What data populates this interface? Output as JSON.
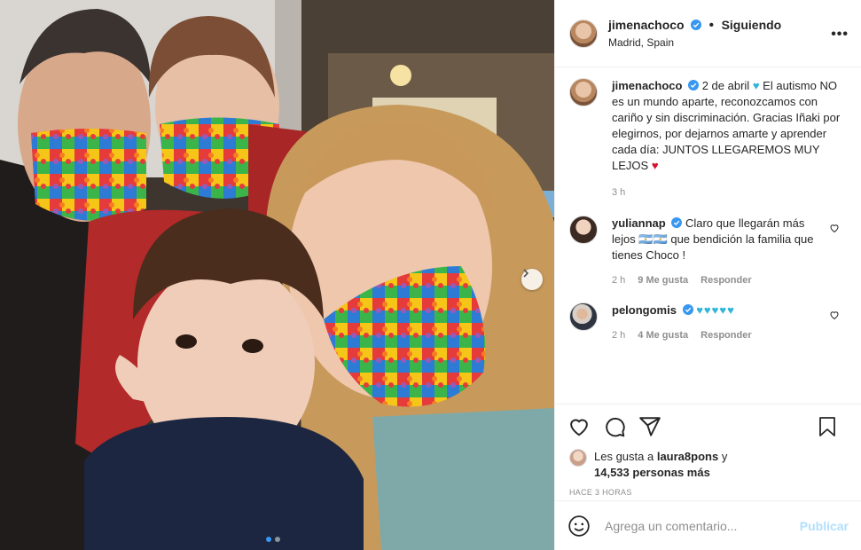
{
  "post": {
    "author": "jimenachoco",
    "follow_status": "Siguiendo",
    "separator": "•",
    "location": "Madrid, Spain",
    "more_icon": "more-horizontal-icon"
  },
  "caption": {
    "username": "jimenachoco",
    "date": "2 de abril",
    "text": "El autismo NO es un mundo aparte, reconozcamos con cariño y sin discriminación. Gracias Iñaki por elegirnos, por dejarnos amarte y aprender cada día: JUNTOS LLEGAREMOS MUY LEJOS",
    "heart_before": "♥",
    "heart_after": "♥",
    "age": "3 h"
  },
  "comments": [
    {
      "username": "yuliannap",
      "text": "Claro que llegarán más lejos 🇦🇷🇦🇷 que bendición la familia que tienes Choco !",
      "age": "2 h",
      "likes": "9 Me gusta",
      "reply": "Responder"
    },
    {
      "username": "pelongomis",
      "text": "♥♥♥♥♥",
      "age": "2 h",
      "likes": "4 Me gusta",
      "reply": "Responder"
    }
  ],
  "likes": {
    "prefix": "Les gusta a",
    "user": "laura8pons",
    "connector": "y",
    "count": "14,533 personas más"
  },
  "timestamp": "Hace 3 horas",
  "composer": {
    "placeholder": "Agrega un comentario...",
    "publish_label": "Publicar"
  },
  "colors": {
    "verified": "#3897f0",
    "link_disabled": "#b2dffc",
    "muted": "#8e8e8e",
    "cyan_heart": "#2fb4d9",
    "red_heart": "#d8102f"
  },
  "carousel": {
    "slides": 2,
    "active": 1
  }
}
